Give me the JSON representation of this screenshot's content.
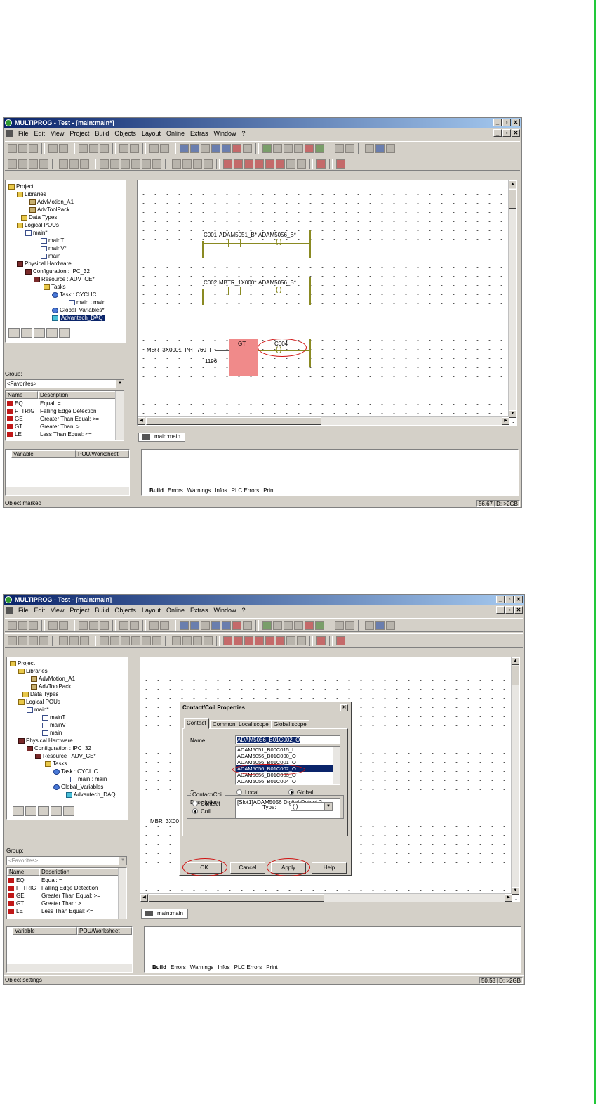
{
  "shot1": {
    "title": "MULTIPROG - Test - [main:main*]",
    "menu": [
      "File",
      "Edit",
      "View",
      "Project",
      "Build",
      "Objects",
      "Layout",
      "Online",
      "Extras",
      "Window",
      "?"
    ],
    "tree": [
      "Project",
      "Libraries",
      "AdvMotion_A1",
      "AdvToolPack",
      "Data Types",
      "Logical POUs",
      "main*",
      "mainT",
      "mainV*",
      "main",
      "Physical Hardware",
      "Configuration : IPC_32",
      "Resource : ADV_CE*",
      "Tasks",
      "Task : CYCLIC",
      "main : main",
      "Global_Variables*",
      "Advantech_DAQ"
    ],
    "group_label": "Group:",
    "group_value": "<Favorites>",
    "col_name": "Name",
    "col_desc": "Description",
    "functions": [
      {
        "name": "EQ",
        "desc": "Equal: ="
      },
      {
        "name": "F_TRIG",
        "desc": "Falling Edge Detection"
      },
      {
        "name": "GE",
        "desc": "Greater Than Equal: >="
      },
      {
        "name": "GT",
        "desc": "Greater Than: >"
      },
      {
        "name": "LE",
        "desc": "Less Than Equal: <="
      }
    ],
    "ladder": {
      "r1_contact": "C001",
      "r1_contact2": "ADAM5051_B*",
      "r1_coil": "ADAM5056_B*",
      "r2_contact": "C002",
      "r2_contact2": "MBTR_1X000*",
      "r2_coil": "ADAM5056_B*",
      "r3_input": "MBR_3X0001_INT_769_I",
      "r3_value": "1196",
      "r3_block": "GT",
      "r3_coil": "C004"
    },
    "worksheet_tab": "main:main",
    "var_col1": "Variable",
    "var_col2": "POU/Worksheet",
    "msg_tabs": [
      "Build",
      "Errors",
      "Warnings",
      "Infos",
      "PLC Errors",
      "Print"
    ],
    "status": "Object marked",
    "status_pos": "56,67",
    "status_disk": "D: >2GB"
  },
  "shot2": {
    "title": "MULTIPROG - Test - [main:main]",
    "menu": [
      "File",
      "Edit",
      "View",
      "Project",
      "Build",
      "Objects",
      "Layout",
      "Online",
      "Extras",
      "Window",
      "?"
    ],
    "tree": [
      "Project",
      "Libraries",
      "AdvMotion_A1",
      "AdvToolPack",
      "Data Types",
      "Logical POUs",
      "main*",
      "mainT",
      "mainV",
      "main",
      "Physical Hardware",
      "Configuration : IPC_32",
      "Resource : ADV_CE*",
      "Tasks",
      "Task : CYCLIC",
      "main : main",
      "Global_Variables",
      "Advantech_DAQ"
    ],
    "group_label": "Group:",
    "group_value": "<Favorites>",
    "col_name": "Name",
    "col_desc": "Description",
    "functions": [
      {
        "name": "EQ",
        "desc": "Equal: ="
      },
      {
        "name": "F_TRIG",
        "desc": "Falling Edge Detection"
      },
      {
        "name": "GE",
        "desc": "Greater Than Equal: >="
      },
      {
        "name": "GT",
        "desc": "Greater Than: >"
      },
      {
        "name": "LE",
        "desc": "Less Than Equal: <="
      }
    ],
    "canvas_partial": "MBR_3X00",
    "worksheet_tab": "main:main",
    "var_col1": "Variable",
    "var_col2": "POU/Worksheet",
    "msg_tabs": [
      "Build",
      "Errors",
      "Warnings",
      "Infos",
      "PLC Errors",
      "Print"
    ],
    "status": "Object settings",
    "status_pos": "50,58",
    "status_disk": "D: >2GB",
    "dialog": {
      "title": "Contact/Coil Properties",
      "tabs": [
        "Contact",
        "Common",
        "Local scope",
        "Global scope"
      ],
      "name_label": "Name:",
      "name_value": "ADAM5056_B01C002_O",
      "list": [
        "ADAM5051_B00C015_I",
        "ADAM5056_B01C000_O",
        "ADAM5056_B01C001_O",
        "ADAM5056_B01C002_O",
        "ADAM5056_B01C003_O",
        "ADAM5056_B01C004_O"
      ],
      "scope_label": "Scope:",
      "scope_local": "Local",
      "scope_global": "Global",
      "desc_label": "Description:",
      "desc_value": "[Slot1]ADAM5056 Digital Output 2",
      "group_label": "Contact/Coil",
      "opt_contact": "Contact",
      "opt_coil": "Coil",
      "type_label": "Type:",
      "type_value": "( )",
      "ok": "OK",
      "cancel": "Cancel",
      "apply": "Apply",
      "help": "Help"
    }
  }
}
